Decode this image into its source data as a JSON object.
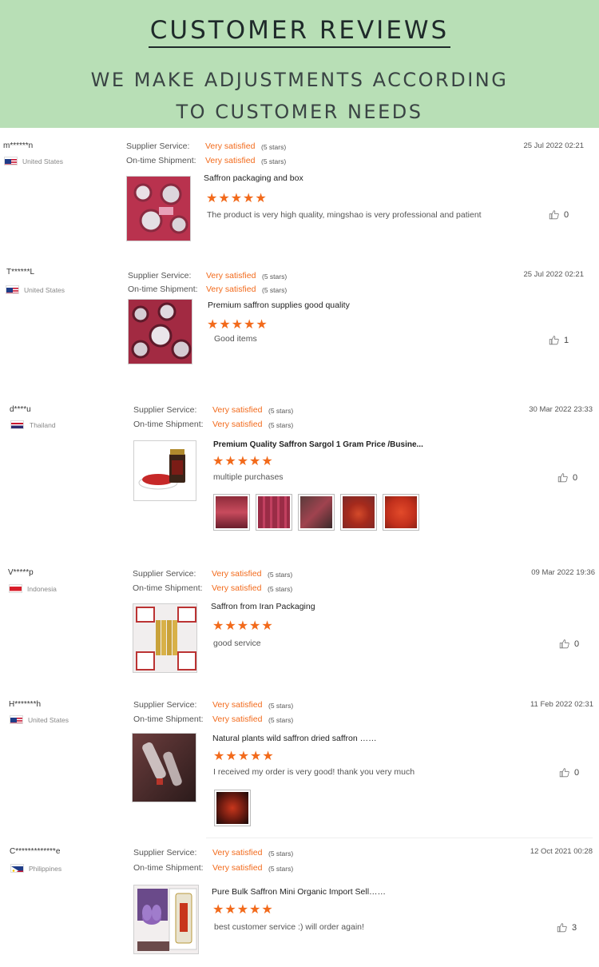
{
  "header": {
    "title": "CUSTOMER REVIEWS",
    "subtitle_line1": "WE MAKE ADJUSTMENTS ACCORDING",
    "subtitle_line2": "TO CUSTOMER NEEDS"
  },
  "labels": {
    "supplier_service": "Supplier Service:",
    "ontime_shipment": "On-time Shipment:"
  },
  "reviews": [
    {
      "user": "m******n",
      "country": "United States",
      "flag_icon": "us-flag-icon",
      "supplier_rating": "Very satisfied",
      "supplier_stars": "(5 stars)",
      "shipment_rating": "Very satisfied",
      "shipment_stars": "(5 stars)",
      "date": "25 Jul 2022 02:21",
      "product_title": "Saffron packaging and box",
      "stars": "★★★★★",
      "comment": "The product is very high quality, mingshao is very professional and patient",
      "likes": "0"
    },
    {
      "user": "T******L",
      "country": "United States",
      "flag_icon": "us-flag-icon",
      "supplier_rating": "Very satisfied",
      "supplier_stars": "(5 stars)",
      "shipment_rating": "Very satisfied",
      "shipment_stars": "(5 stars)",
      "date": "25 Jul 2022 02:21",
      "product_title": "Premium saffron supplies good quality",
      "stars": "★★★★★",
      "comment": "Good  items",
      "likes": "1"
    },
    {
      "user": "d****u",
      "country": "Thailand",
      "flag_icon": "thailand-flag-icon",
      "supplier_rating": "Very satisfied",
      "supplier_stars": "(5 stars)",
      "shipment_rating": "Very satisfied",
      "shipment_stars": "(5 stars)",
      "date": "30 Mar 2022 23:33",
      "product_title": "Premium Quality Saffron Sargol 1 Gram Price /Busine...",
      "stars": "★★★★★",
      "comment": "multiple purchases",
      "likes": "0"
    },
    {
      "user": "V*****p",
      "country": "Indonesia",
      "flag_icon": "indonesia-flag-icon",
      "supplier_rating": "Very satisfied",
      "supplier_stars": "(5 stars)",
      "shipment_rating": "Very satisfied",
      "shipment_stars": "(5 stars)",
      "date": "09 Mar 2022 19:36",
      "product_title": "Saffron from Iran Packaging",
      "stars": "★★★★★",
      "comment": "good service",
      "likes": "0"
    },
    {
      "user": "H*******h",
      "country": "United States",
      "flag_icon": "us-flag-icon",
      "supplier_rating": "Very satisfied",
      "supplier_stars": "(5 stars)",
      "shipment_rating": "Very satisfied",
      "shipment_stars": "(5 stars)",
      "date": "11 Feb 2022 02:31",
      "product_title": "Natural plants wild saffron dried saffron ……",
      "stars": "★★★★★",
      "comment": "I received my order is very good! thank you very much",
      "likes": "0"
    },
    {
      "user": "C*************e",
      "country": "Philippines",
      "flag_icon": "philippines-flag-icon",
      "supplier_rating": "Very satisfied",
      "supplier_stars": "(5 stars)",
      "shipment_rating": "Very satisfied",
      "shipment_stars": "(5 stars)",
      "date": "12 Oct 2021 00:28",
      "product_title": "Pure Bulk Saffron Mini Organic Import Sell……",
      "stars": "★★★★★",
      "comment": "best customer service :) will order again!",
      "likes": "3"
    }
  ],
  "colors": {
    "banner_bg": "#b8dfb6",
    "rating_orange": "#f26a1b"
  }
}
